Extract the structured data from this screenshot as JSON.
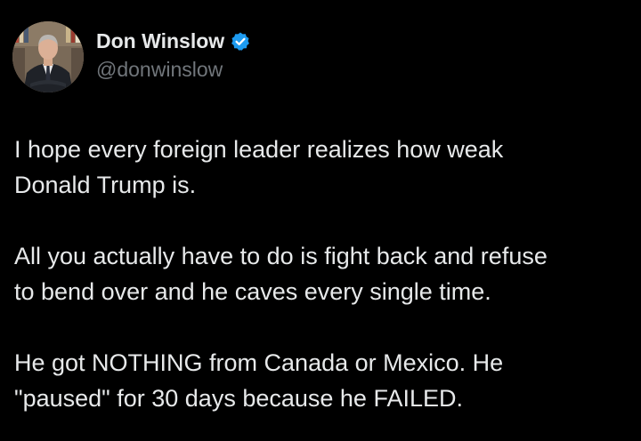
{
  "author": {
    "display_name": "Don Winslow",
    "handle": "@donwinslow",
    "verified": true,
    "verified_color": "#1d9bf0",
    "avatar_icon": "profile-photo"
  },
  "tweet": {
    "paragraphs": [
      "I hope every foreign leader realizes how weak\nDonald Trump is.",
      "All you actually have to do is fight back and refuse\nto bend over and he caves every single time.",
      "He got NOTHING from Canada or Mexico. He\n\"paused\" for 30 days because he FAILED."
    ]
  },
  "colors": {
    "background": "#000000",
    "text": "#e7e9ea",
    "secondary_text": "#71767b"
  }
}
